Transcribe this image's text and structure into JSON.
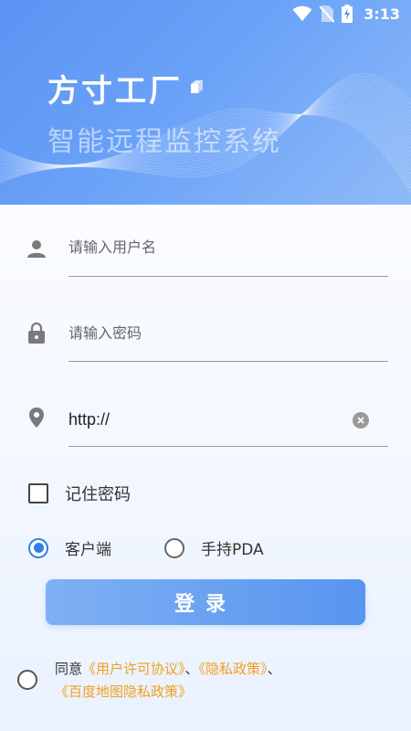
{
  "status_bar": {
    "time": "3:13"
  },
  "header": {
    "title": "方寸工厂",
    "subtitle": "智能远程监控系统"
  },
  "form": {
    "username": {
      "value": "",
      "placeholder": "请输入用户名",
      "icon": "user-icon"
    },
    "password": {
      "value": "",
      "placeholder": "请输入密码",
      "icon": "lock-icon"
    },
    "server": {
      "value": "http://",
      "placeholder": "",
      "icon": "location-pin-icon"
    }
  },
  "remember": {
    "label": "记住密码",
    "checked": false
  },
  "client_type": {
    "options": [
      {
        "label": "客户端",
        "checked": true
      },
      {
        "label": "手持PDA",
        "checked": false
      }
    ]
  },
  "login_button": {
    "label": "登录"
  },
  "agreement": {
    "prefix": "同意",
    "user_agreement": "《用户许可协议》",
    "sep1": "、",
    "privacy_policy": "《隐私政策》",
    "sep2": "、",
    "baidu_privacy": "《百度地图隐私政策》",
    "checked": false
  },
  "colors": {
    "header_blue": "#5b93f3",
    "accent_blue": "#2f7fe6",
    "link_orange": "#f0a020"
  }
}
